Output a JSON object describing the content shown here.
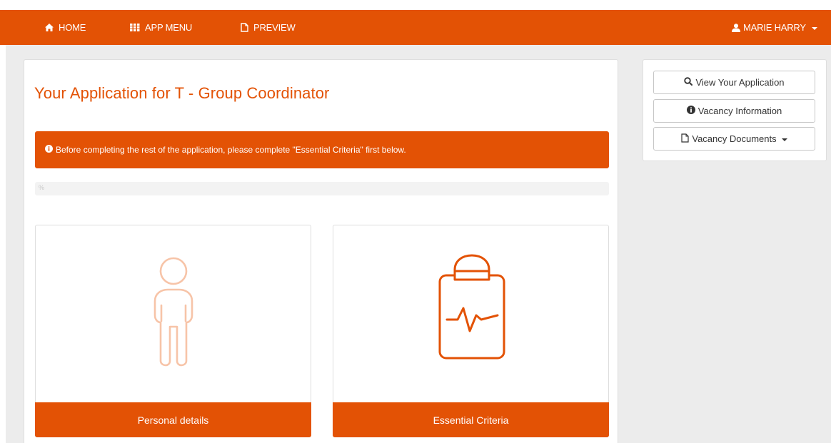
{
  "colors": {
    "brand": "#e35205",
    "brand_light": "#f7c4a8",
    "page_bg": "#ececec"
  },
  "navbar": {
    "items": [
      {
        "label": "HOME",
        "icon": "home-icon"
      },
      {
        "label": "APP MENU",
        "icon": "grid-icon"
      },
      {
        "label": "PREVIEW",
        "icon": "file-icon"
      }
    ],
    "user": {
      "label": "MARIE HARRY",
      "icon": "user-icon"
    }
  },
  "main": {
    "title": "Your Application for T - Group Coordinator",
    "alert": "Before completing the rest of the application, please complete \"Essential Criteria\" first below.",
    "progress": {
      "label": "%",
      "percent": 0
    },
    "cards": [
      {
        "label": "Personal details",
        "icon": "person-icon",
        "state": "inactive"
      },
      {
        "label": "Essential Criteria",
        "icon": "clipboard-heartbeat-icon",
        "state": "active"
      }
    ]
  },
  "sidebar": {
    "buttons": [
      {
        "label": "View Your Application",
        "icon": "search-icon"
      },
      {
        "label": "Vacancy Information",
        "icon": "info-icon"
      },
      {
        "label": "Vacancy Documents",
        "icon": "file-icon"
      }
    ]
  }
}
